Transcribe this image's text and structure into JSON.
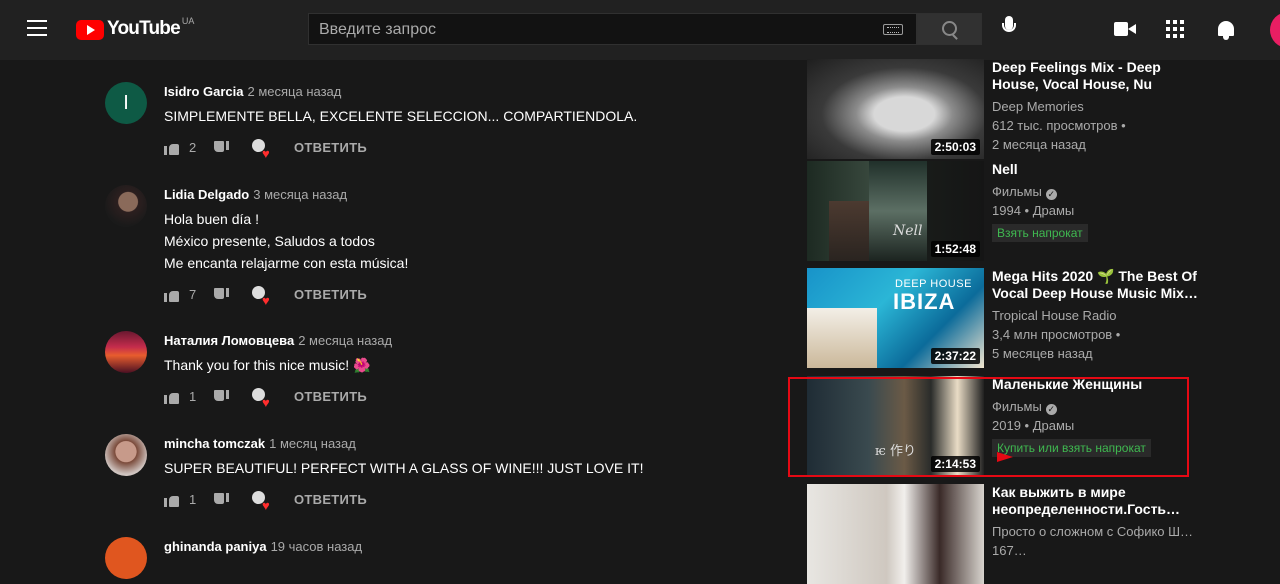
{
  "header": {
    "logo_text": "YouTube",
    "logo_region": "UA",
    "search_placeholder": "Введите запрос",
    "icons": [
      "menu-icon",
      "youtube-logo",
      "keyboard-icon",
      "search-icon",
      "mic-icon",
      "create-video-icon",
      "apps-icon",
      "notifications-icon",
      "account-avatar"
    ]
  },
  "comments": [
    {
      "avatar_letter": "I",
      "author": "Isidro Garcia",
      "time": "2 месяца назад",
      "lines": [
        "SIMPLEMENTE BELLA, EXCELENTE SELECCION... COMPARTIENDOLA."
      ],
      "likes": "2",
      "reply": "ОТВЕТИТЬ"
    },
    {
      "avatar_letter": "",
      "author": "Lidia Delgado",
      "time": "3 месяца назад",
      "lines": [
        "Hola buen día !",
        "México presente, Saludos a todos",
        "Me encanta relajarme con esta música!"
      ],
      "likes": "7",
      "reply": "ОТВЕТИТЬ"
    },
    {
      "avatar_letter": "",
      "author": "Наталия Ломовцева",
      "time": "2 месяца назад",
      "lines": [
        "Thank you for this nice music! 🌺"
      ],
      "likes": "1",
      "reply": "ОТВЕТИТЬ"
    },
    {
      "avatar_letter": "",
      "author": "mincha tomczak",
      "time": "1 месяц назад",
      "lines": [
        "SUPER BEAUTIFUL! PERFECT WITH A GLASS OF WINE!!! JUST LOVE IT!"
      ],
      "likes": "1",
      "reply": "ОТВЕТИТЬ"
    },
    {
      "avatar_letter": "",
      "author": "ghinanda paniya",
      "time": "19 часов назад",
      "lines": [],
      "likes": "",
      "reply": ""
    }
  ],
  "sidebar": [
    {
      "title": "Deep Feelings Mix - Deep House, Vocal House, Nu Disco…",
      "channel": "Deep Memories",
      "meta1": "612 тыс. просмотров •",
      "meta2": "2 месяца назад",
      "duration": "2:50:03",
      "verified": false,
      "badge": ""
    },
    {
      "title": "Nell",
      "channel": "Фильмы",
      "meta1": "1994 • Драмы",
      "meta2": "",
      "duration": "1:52:48",
      "verified": true,
      "badge": "Взять напрокат",
      "thumb_text": "Nell"
    },
    {
      "title": "Mega Hits 2020 🌱 The Best Of Vocal Deep House Music Mix…",
      "channel": "Tropical House Radio",
      "meta1": "3,4 млн просмотров •",
      "meta2": "5 месяцев назад",
      "duration": "2:37:22",
      "verified": false,
      "badge": "",
      "thumb_text_a": "DEEP HOUSE",
      "thumb_text_b": "IBIZA"
    },
    {
      "title": "Маленькие Женщины",
      "channel": "Фильмы",
      "meta1": "2019 • Драмы",
      "meta2": "",
      "duration": "2:14:53",
      "verified": true,
      "badge": "Купить или взять напрокат"
    },
    {
      "title": "Как выжить в мире неопределенности.Гость…",
      "channel": "Просто о сложном с Софико Ш…",
      "meta1": "167…",
      "meta2": "",
      "duration": "",
      "verified": false,
      "badge": ""
    }
  ],
  "colors": {
    "background": "#181818",
    "header": "#212121",
    "accent_red": "#ff0000",
    "badge_green": "#3fb950",
    "highlight": "#e50914"
  }
}
